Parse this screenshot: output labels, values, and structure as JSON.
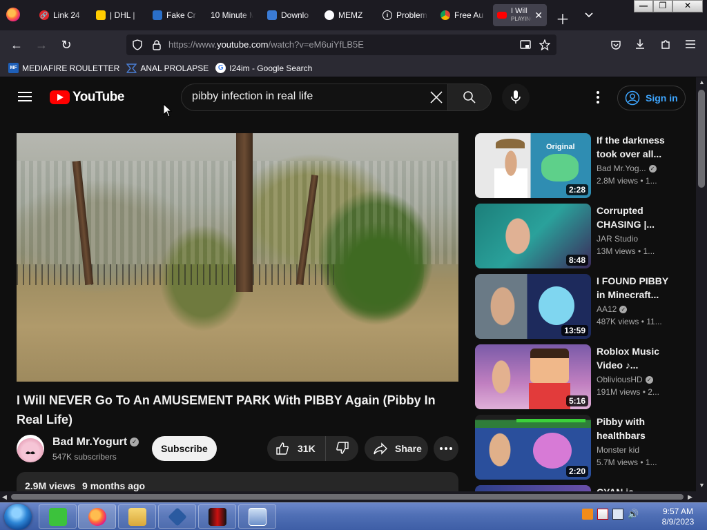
{
  "browser": {
    "tabs": [
      {
        "label": "Link 24",
        "icon": "link-favicon"
      },
      {
        "label": "| DHL |",
        "icon": "dhl-favicon"
      },
      {
        "label": "Fake Cr",
        "icon": "fake-favicon"
      },
      {
        "label": "10 Minute M",
        "icon": "blank-favicon"
      },
      {
        "label": "Downlo",
        "icon": "download-favicon"
      },
      {
        "label": "MEMZ",
        "icon": "github-favicon"
      },
      {
        "label": "Problem",
        "icon": "info-favicon"
      },
      {
        "label": "Free Au",
        "icon": "chrome-favicon"
      }
    ],
    "active_tab": {
      "title": "I Will",
      "subtitle": "PLAYING",
      "icon": "youtube-favicon"
    },
    "url_prefix": "https://www.",
    "url_domain": "youtube.com",
    "url_path": "/watch?v=eM6uiYfLB5E",
    "bookmarks": [
      {
        "label": "MEDIAFIRE ROULETTER",
        "icon": "mediafire-favicon",
        "icon_text": "MF"
      },
      {
        "label": "ANAL PROLAPSE",
        "icon": "bookmark-favicon",
        "icon_text": ""
      },
      {
        "label": "I24im - Google Search",
        "icon": "google-favicon",
        "icon_text": "G"
      }
    ]
  },
  "youtube": {
    "logo_text": "YouTube",
    "search_value": "pibby infection in real life",
    "signin_label": "Sign in",
    "video": {
      "title": "I Will NEVER Go To An AMUSEMENT PARK With PIBBY Again (Pibby In Real Life)",
      "channel": "Bad Mr.Yogurt",
      "subscribers": "547K subscribers",
      "subscribe_label": "Subscribe",
      "likes": "31K",
      "share_label": "Share",
      "views": "2.9M views",
      "age": "9 months ago"
    },
    "related": [
      {
        "title": "If the darkness took over all...",
        "channel": "Bad Mr.Yog...",
        "verified": true,
        "views": "2.8M views",
        "age": "1...",
        "duration": "2:28",
        "thumb_label": "Original"
      },
      {
        "title": "Corrupted CHASING |...",
        "channel": "JAR Studio",
        "verified": false,
        "views": "13M views",
        "age": "1...",
        "duration": "8:48",
        "thumb_label": ""
      },
      {
        "title": "I FOUND PIBBY in Minecraft...",
        "channel": "AA12",
        "verified": true,
        "views": "487K views",
        "age": "11...",
        "duration": "13:59",
        "thumb_label": ""
      },
      {
        "title": "Roblox Music Video ♪...",
        "channel": "ObliviousHD",
        "verified": true,
        "views": "191M views",
        "age": "2...",
        "duration": "5:16",
        "thumb_label": ""
      },
      {
        "title": "Pibby with healthbars",
        "channel": "Monster kid",
        "verified": false,
        "views": "5.7M views",
        "age": "1...",
        "duration": "2:20",
        "thumb_label": ""
      },
      {
        "title": "CYAN is",
        "channel": "",
        "verified": false,
        "views": "",
        "age": "",
        "duration": "",
        "thumb_label": ""
      }
    ]
  },
  "taskbar": {
    "time": "9:57 AM",
    "date": "8/9/2023"
  },
  "colors": {
    "yt_red": "#ff0000",
    "link_blue": "#3ea6ff",
    "bg": "#0f0f0f"
  }
}
